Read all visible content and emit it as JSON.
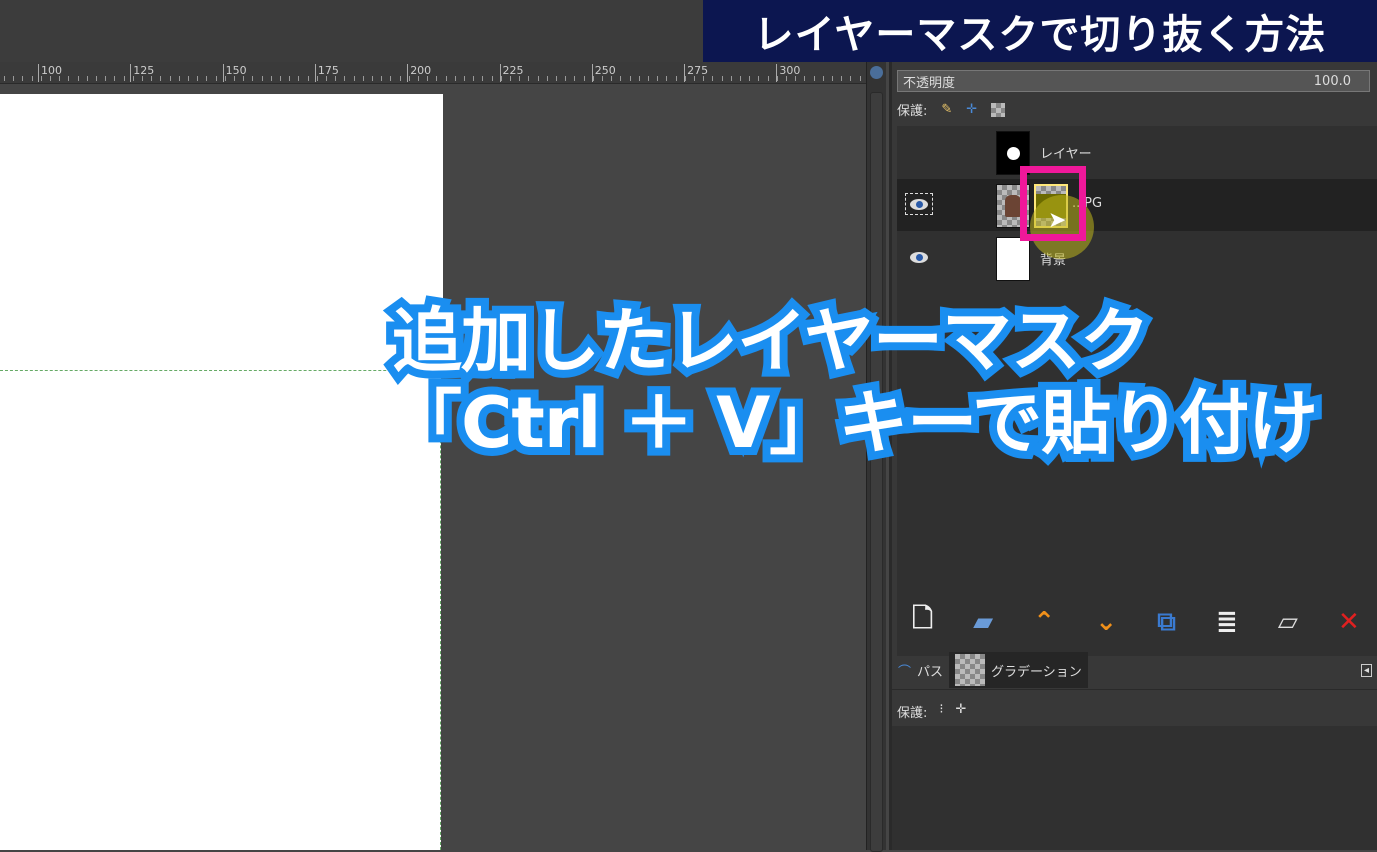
{
  "title_banner": "レイヤーマスクで切り抜く方法",
  "ruler": {
    "ticks": [
      "100",
      "125",
      "150",
      "175",
      "200",
      "225",
      "250",
      "275",
      "300"
    ]
  },
  "layers_panel": {
    "opacity_label": "不透明度",
    "opacity_value": "100.0",
    "lock_label": "保護:",
    "layers": [
      {
        "name": "レイヤー",
        "visible": false
      },
      {
        "name": "..JPG",
        "visible": true,
        "selected": true
      },
      {
        "name": "背景",
        "visible": true
      }
    ],
    "toolbar_icons": [
      "new-layer-icon",
      "new-layer-group-icon",
      "raise-layer-icon",
      "lower-layer-icon",
      "duplicate-layer-icon",
      "merge-down-icon",
      "anchor-layer-icon",
      "delete-layer-icon"
    ],
    "tabs": [
      {
        "label": "パス"
      },
      {
        "label": "グラデーション"
      }
    ],
    "lock_label2": "保護:"
  },
  "caption": {
    "line1": "追加したレイヤーマスク",
    "line2": "「Ctrl ＋ V」キーで貼り付け"
  },
  "colors": {
    "banner": "#0c1650",
    "caption_stroke": "#1a8ef0",
    "highlight": "#f0189a"
  }
}
